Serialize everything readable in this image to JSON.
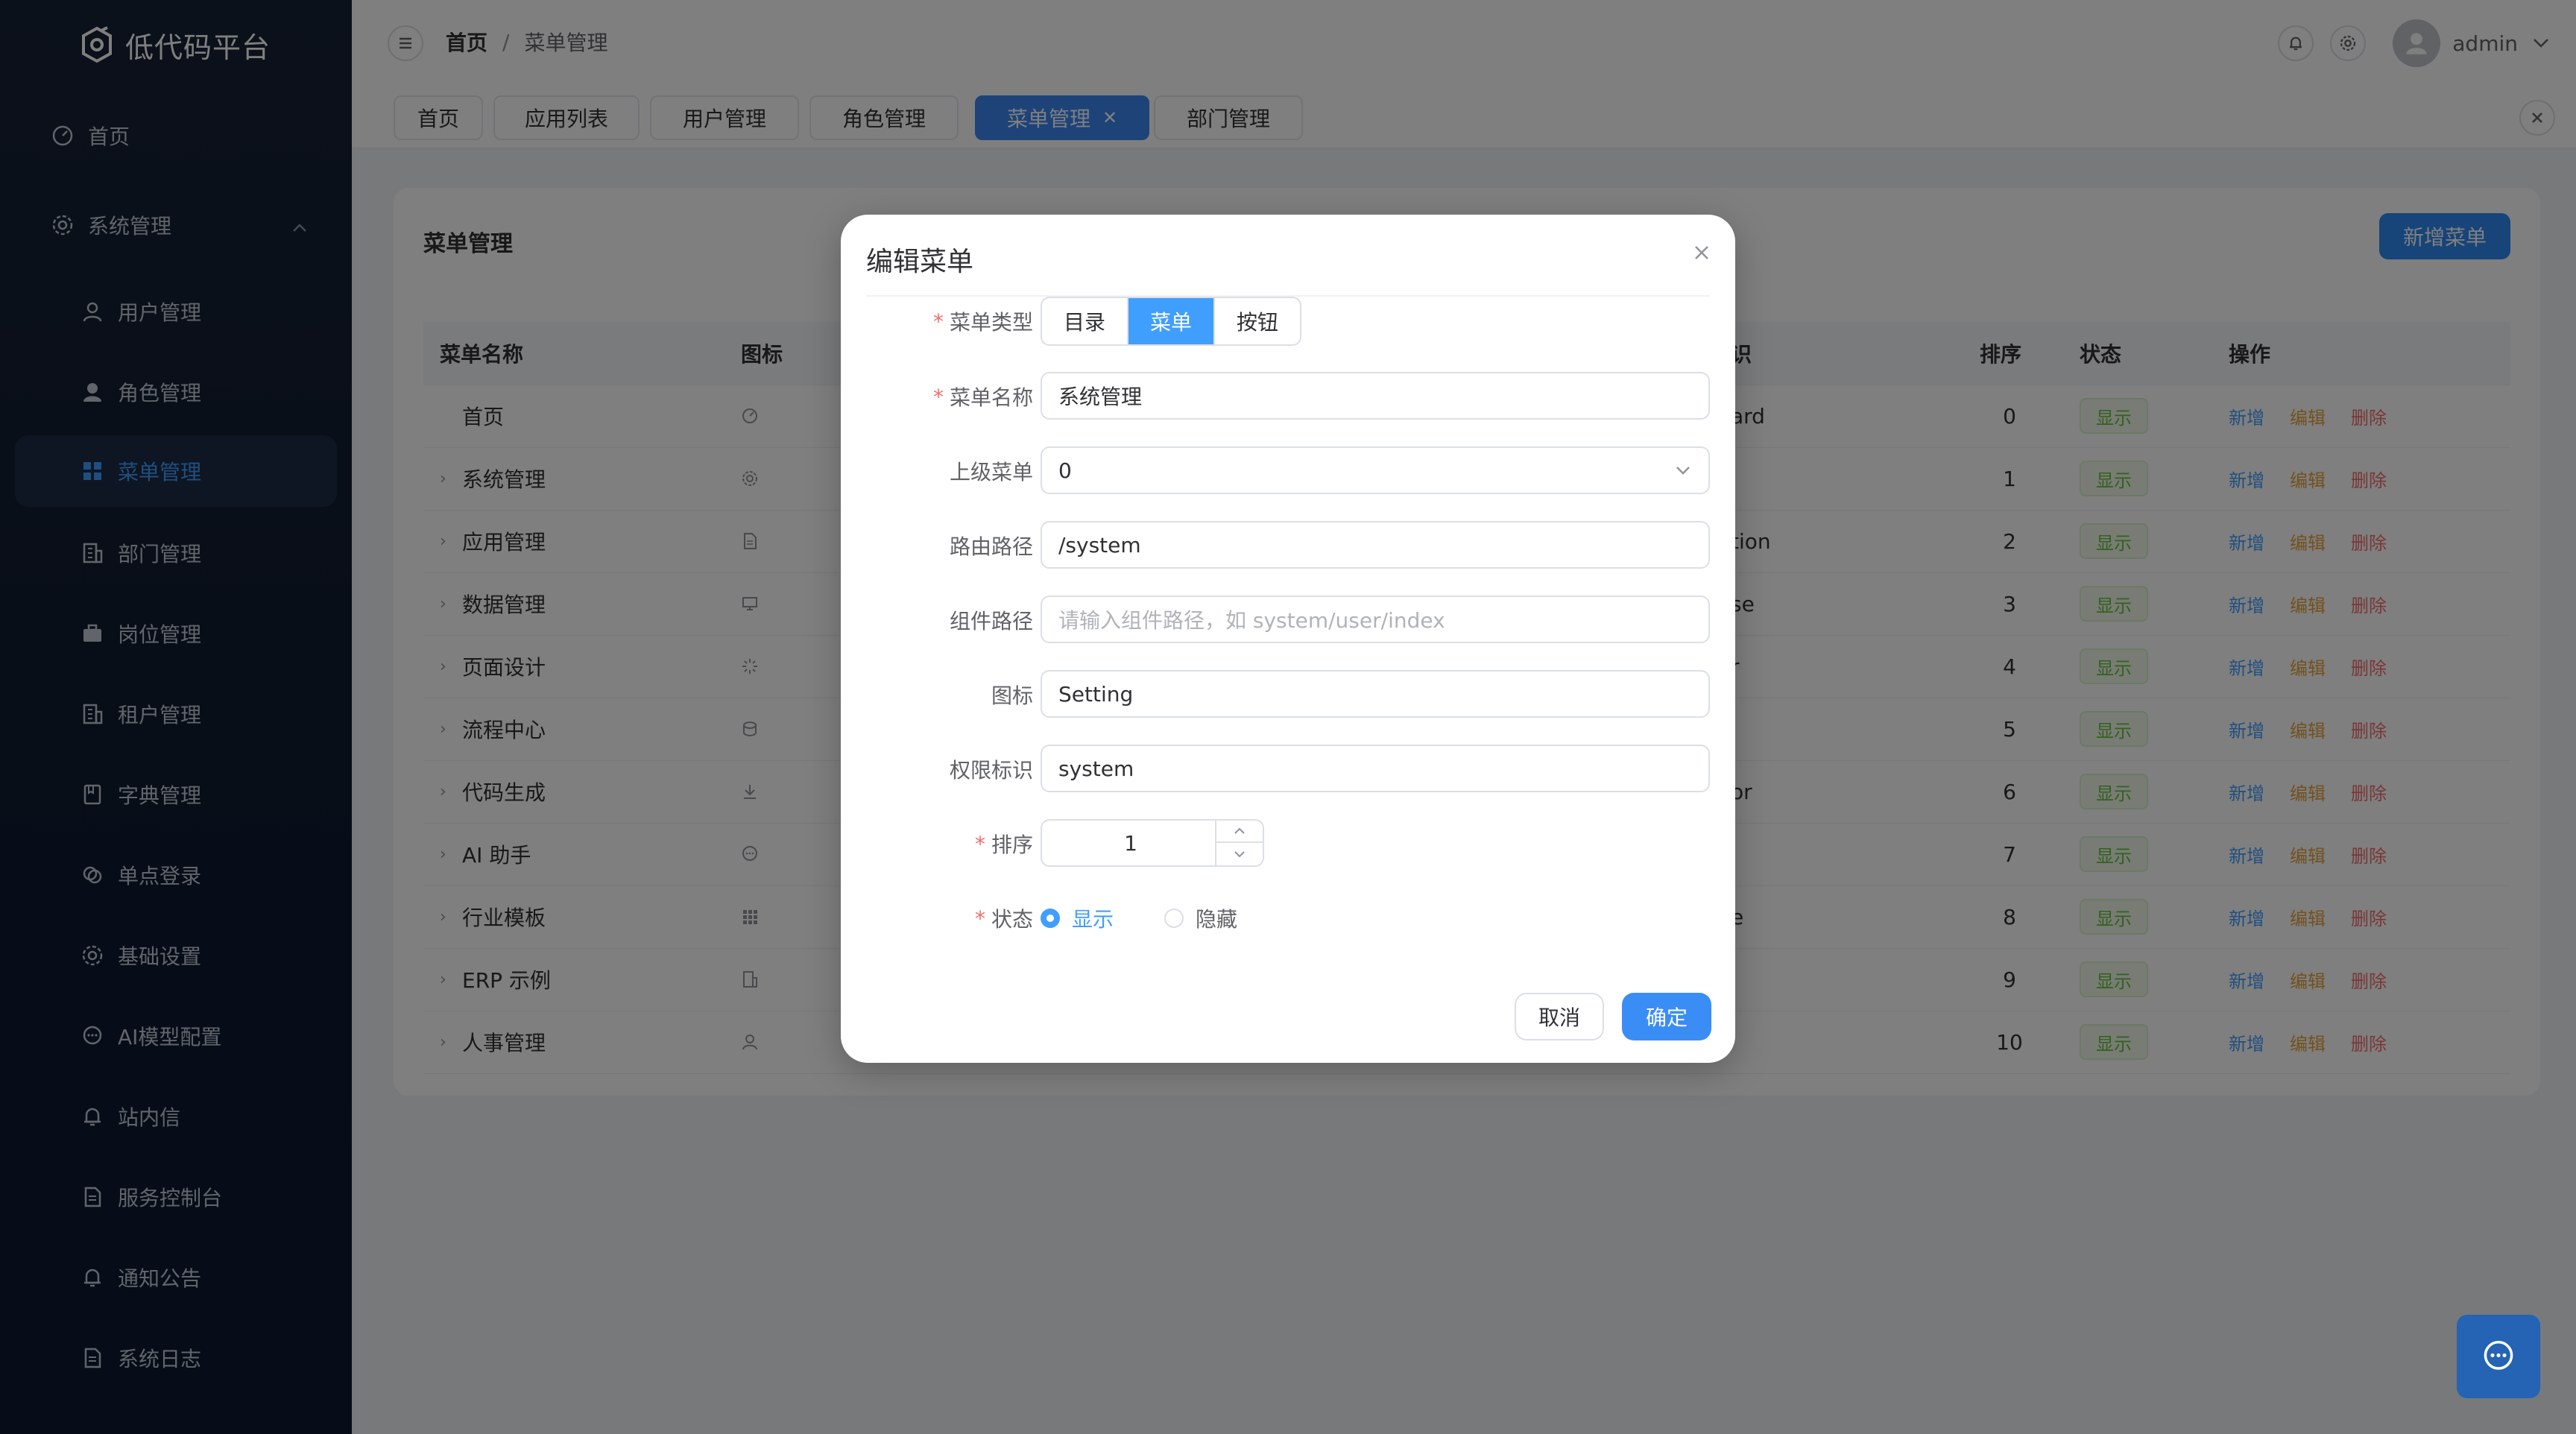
{
  "app": {
    "title": "低代码平台"
  },
  "sidebar": {
    "items": [
      {
        "label": "首页",
        "icon": "dashboard-icon"
      },
      {
        "label": "系统管理",
        "icon": "gear-icon",
        "expanded": true
      },
      {
        "label": "用户管理",
        "icon": "user-icon"
      },
      {
        "label": "角色管理",
        "icon": "user-filled-icon"
      },
      {
        "label": "菜单管理",
        "icon": "menu-grid-icon",
        "active": true
      },
      {
        "label": "部门管理",
        "icon": "building-icon"
      },
      {
        "label": "岗位管理",
        "icon": "briefcase-icon"
      },
      {
        "label": "租户管理",
        "icon": "building-icon"
      },
      {
        "label": "字典管理",
        "icon": "book-icon"
      },
      {
        "label": "单点登录",
        "icon": "link-icon"
      },
      {
        "label": "基础设置",
        "icon": "gear-icon"
      },
      {
        "label": "AI模型配置",
        "icon": "chat-icon"
      },
      {
        "label": "站内信",
        "icon": "bell-icon"
      },
      {
        "label": "服务控制台",
        "icon": "document-icon"
      },
      {
        "label": "通知公告",
        "icon": "bell-icon"
      },
      {
        "label": "系统日志",
        "icon": "document-icon"
      }
    ]
  },
  "header": {
    "breadcrumb": [
      "首页",
      "菜单管理"
    ],
    "user": "admin"
  },
  "tabs": [
    {
      "label": "首页"
    },
    {
      "label": "应用列表"
    },
    {
      "label": "用户管理"
    },
    {
      "label": "角色管理"
    },
    {
      "label": "菜单管理",
      "active": true,
      "close": "✕"
    },
    {
      "label": "部门管理"
    }
  ],
  "card": {
    "title": "菜单管理",
    "add_label": "新增菜单"
  },
  "table": {
    "columns": [
      "菜单名称",
      "图标",
      "识",
      "排序",
      "状态",
      "操作"
    ],
    "rows": [
      {
        "name": "首页",
        "icon": "dashboard-icon",
        "perm": "ard",
        "order": "0",
        "status": "显示",
        "caret": false
      },
      {
        "name": "系统管理",
        "icon": "gear-icon",
        "perm": "",
        "order": "1",
        "status": "显示",
        "caret": true
      },
      {
        "name": "应用管理",
        "icon": "document-icon",
        "perm": "tion",
        "order": "2",
        "status": "显示",
        "caret": true
      },
      {
        "name": "数据管理",
        "icon": "monitor-icon",
        "perm": "se",
        "order": "3",
        "status": "显示",
        "caret": true
      },
      {
        "name": "页面设计",
        "icon": "loading-icon",
        "perm": "r",
        "order": "4",
        "status": "显示",
        "caret": true
      },
      {
        "name": "流程中心",
        "icon": "coin-icon",
        "perm": "",
        "order": "5",
        "status": "显示",
        "caret": true
      },
      {
        "name": "代码生成",
        "icon": "download-icon",
        "perm": "or",
        "order": "6",
        "status": "显示",
        "caret": true
      },
      {
        "name": "AI 助手",
        "icon": "chat-icon",
        "perm": "",
        "order": "7",
        "status": "显示",
        "caret": true
      },
      {
        "name": "行业模板",
        "icon": "grid-icon",
        "perm": "e",
        "order": "8",
        "status": "显示",
        "caret": true
      },
      {
        "name": "ERP 示例",
        "icon": "building-icon",
        "perm": "",
        "order": "9",
        "status": "显示",
        "caret": true
      },
      {
        "name": "人事管理",
        "icon": "user-icon",
        "perm": "",
        "order": "10",
        "status": "显示",
        "caret": true
      }
    ],
    "ops": {
      "add": "新增",
      "edit": "编辑",
      "del": "删除"
    }
  },
  "dialog": {
    "title": "编辑菜单",
    "fields": {
      "type": {
        "label": "菜单类型",
        "options": [
          "目录",
          "菜单",
          "按钮"
        ],
        "selected": "菜单"
      },
      "name": {
        "label": "菜单名称",
        "value": "系统管理"
      },
      "parent": {
        "label": "上级菜单",
        "value": "0"
      },
      "route": {
        "label": "路由路径",
        "value": "/system"
      },
      "component": {
        "label": "组件路径",
        "placeholder": "请输入组件路径，如 system/user/index"
      },
      "icon": {
        "label": "图标",
        "value": "Setting"
      },
      "perm": {
        "label": "权限标识",
        "value": "system"
      },
      "order": {
        "label": "排序",
        "value": "1"
      },
      "status": {
        "label": "状态",
        "options": [
          "显示",
          "隐藏"
        ],
        "selected": "显示"
      }
    },
    "cancel_label": "取消",
    "ok_label": "确定"
  },
  "colors": {
    "primary": "#409eff",
    "sidebar_bg": "#13203a",
    "success": "#67c23a",
    "warning": "#e6a23c",
    "danger": "#f56c6c"
  }
}
